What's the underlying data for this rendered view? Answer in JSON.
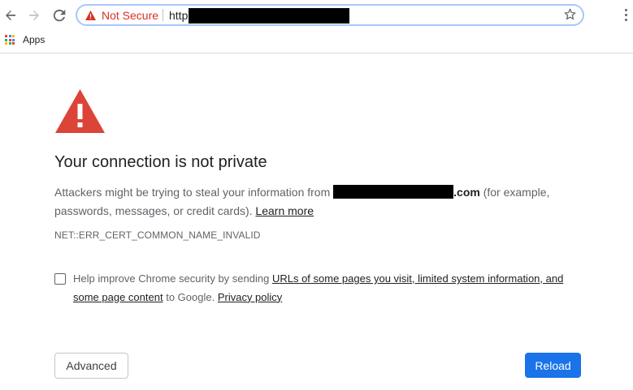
{
  "toolbar": {
    "security_label": "Not Secure",
    "url_visible_prefix": "http",
    "icons": [
      "back-arrow-icon",
      "forward-arrow-icon",
      "reload-icon",
      "warning-triangle-icon",
      "star-icon",
      "more-menu-icon"
    ]
  },
  "bookmarks": {
    "apps_label": "Apps",
    "apps_icon": "apps-grid-icon"
  },
  "interstitial": {
    "title": "Your connection is not private",
    "body_prefix": "Attackers might be trying to steal your information from",
    "domain_suffix": ".com",
    "body_middle": " (for example, passwords, messages, or credit cards).",
    "learn_more": "Learn more",
    "error_code": "NET::ERR_CERT_COMMON_NAME_INVALID",
    "help_prefix": "Help improve Chrome security by sending",
    "help_link": "URLs of some pages you visit, limited system information, and some page content",
    "help_mid": "to Google.",
    "privacy_link": "Privacy policy",
    "checkbox_checked": false,
    "advanced_label": "Advanced",
    "reload_label": "Reload"
  },
  "colors": {
    "warning_red": "#d93025",
    "icon_red": "#db4437",
    "primary_blue": "#1a73e8",
    "omnibox_border": "#a8c7fa"
  }
}
